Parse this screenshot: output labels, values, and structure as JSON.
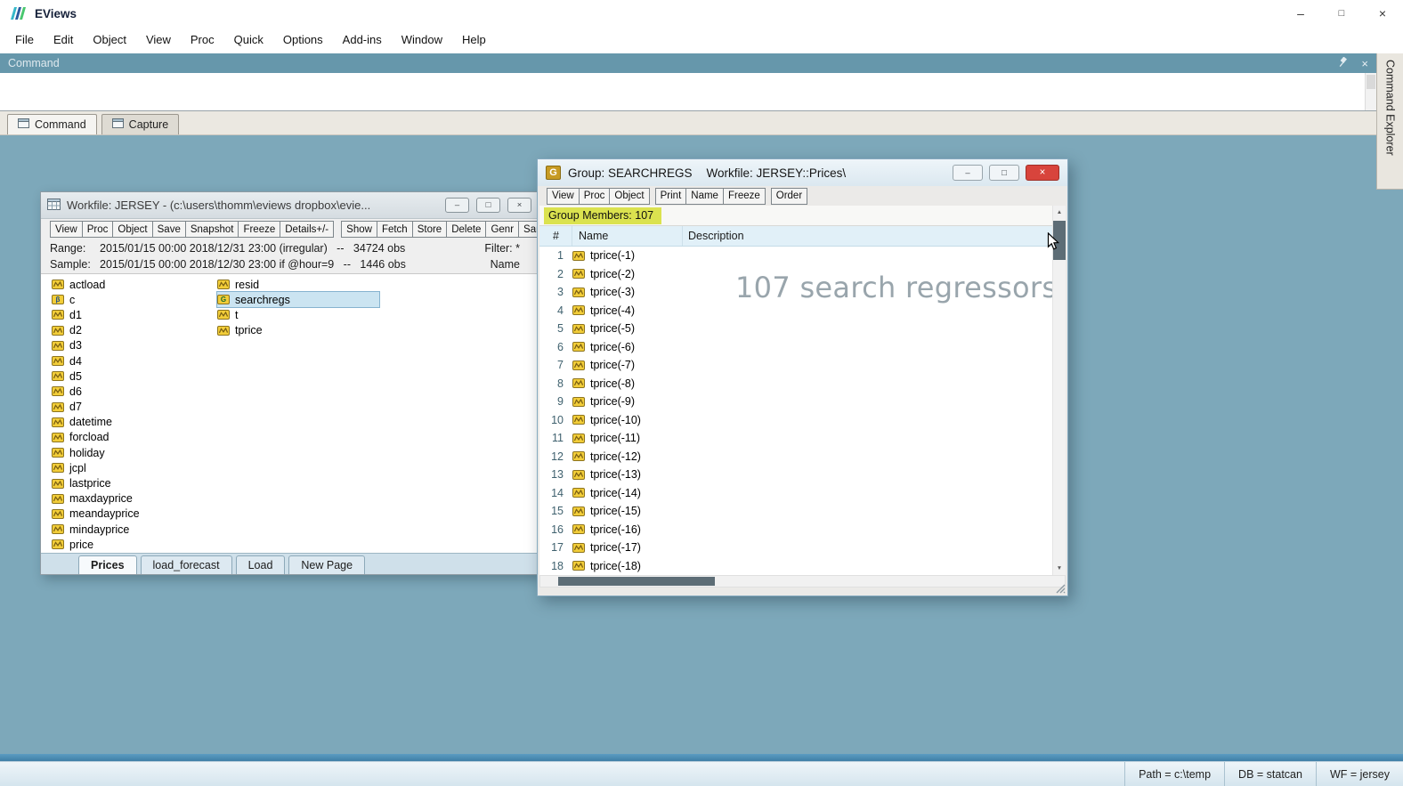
{
  "icons": {
    "minimize": "–",
    "maximize": "□",
    "restore": "□",
    "close": "×",
    "scroll_up": "▲",
    "scroll_down": "▼"
  },
  "titlebar": {
    "app_name": "EViews"
  },
  "menubar": {
    "items": [
      "File",
      "Edit",
      "Object",
      "View",
      "Proc",
      "Quick",
      "Options",
      "Add-ins",
      "Window",
      "Help"
    ]
  },
  "command_panel": {
    "title": "Command",
    "input_value": "",
    "tabs": [
      {
        "label": "Command",
        "active": true
      },
      {
        "label": "Capture",
        "active": false
      }
    ],
    "explorer_tab": "Command Explorer"
  },
  "workfile": {
    "title": "Workfile: JERSEY - (c:\\users\\thomm\\eviews dropbox\\evie...",
    "toolbar_group1": [
      "View",
      "Proc",
      "Object",
      "Save",
      "Snapshot",
      "Freeze",
      "Details+/-"
    ],
    "toolbar_group2": [
      "Show",
      "Fetch",
      "Store",
      "Delete",
      "Genr",
      "Sample"
    ],
    "info": {
      "range_label": "Range:",
      "range_value": "2015/01/15 00:00 2018/12/31 23:00 (irregular)   --   34724 obs",
      "filter_label": "Filter: *",
      "sample_label": "Sample:",
      "sample_value": "2015/01/15 00:00 2018/12/30 23:00 if @hour=9   --   1446 obs",
      "name_label": "Name"
    },
    "objects_col1": [
      {
        "name": "actload",
        "type": "series"
      },
      {
        "name": "c",
        "type": "coef"
      },
      {
        "name": "d1",
        "type": "series"
      },
      {
        "name": "d2",
        "type": "series"
      },
      {
        "name": "d3",
        "type": "series"
      },
      {
        "name": "d4",
        "type": "series"
      },
      {
        "name": "d5",
        "type": "series"
      },
      {
        "name": "d6",
        "type": "series"
      },
      {
        "name": "d7",
        "type": "series"
      },
      {
        "name": "datetime",
        "type": "series"
      },
      {
        "name": "forcload",
        "type": "series"
      },
      {
        "name": "holiday",
        "type": "series"
      },
      {
        "name": "jcpl",
        "type": "series"
      },
      {
        "name": "lastprice",
        "type": "series"
      },
      {
        "name": "maxdayprice",
        "type": "series"
      },
      {
        "name": "meandayprice",
        "type": "series"
      },
      {
        "name": "mindayprice",
        "type": "series"
      },
      {
        "name": "price",
        "type": "series"
      }
    ],
    "objects_col2": [
      {
        "name": "resid",
        "type": "series"
      },
      {
        "name": "searchregs",
        "type": "group",
        "selected": true
      },
      {
        "name": "t",
        "type": "series"
      },
      {
        "name": "tprice",
        "type": "series"
      }
    ],
    "page_tabs": [
      {
        "label": "Prices",
        "active": true
      },
      {
        "label": "load_forecast",
        "active": false
      },
      {
        "label": "Load",
        "active": false
      },
      {
        "label": "New Page",
        "active": false
      }
    ]
  },
  "group_window": {
    "icon_letter": "G",
    "title_group": "Group: SEARCHREGS",
    "title_workfile": "Workfile: JERSEY::Prices\\",
    "toolbar_group1": [
      "View",
      "Proc",
      "Object"
    ],
    "toolbar_group2": [
      "Print",
      "Name",
      "Freeze"
    ],
    "toolbar_group3": [
      "Order"
    ],
    "members_label": "Group Members: 107",
    "columns": {
      "num": "#",
      "name": "Name",
      "description": "Description"
    },
    "watermark": "107 search regressors",
    "rows": [
      {
        "n": "1",
        "name": "tprice(-1)"
      },
      {
        "n": "2",
        "name": "tprice(-2)"
      },
      {
        "n": "3",
        "name": "tprice(-3)"
      },
      {
        "n": "4",
        "name": "tprice(-4)"
      },
      {
        "n": "5",
        "name": "tprice(-5)"
      },
      {
        "n": "6",
        "name": "tprice(-6)"
      },
      {
        "n": "7",
        "name": "tprice(-7)"
      },
      {
        "n": "8",
        "name": "tprice(-8)"
      },
      {
        "n": "9",
        "name": "tprice(-9)"
      },
      {
        "n": "10",
        "name": "tprice(-10)"
      },
      {
        "n": "11",
        "name": "tprice(-11)"
      },
      {
        "n": "12",
        "name": "tprice(-12)"
      },
      {
        "n": "13",
        "name": "tprice(-13)"
      },
      {
        "n": "14",
        "name": "tprice(-14)"
      },
      {
        "n": "15",
        "name": "tprice(-15)"
      },
      {
        "n": "16",
        "name": "tprice(-16)"
      },
      {
        "n": "17",
        "name": "tprice(-17)"
      },
      {
        "n": "18",
        "name": "tprice(-18)"
      }
    ]
  },
  "statusbar": {
    "path": "Path = c:\\temp",
    "db": "DB = statcan",
    "wf": "WF = jersey"
  }
}
